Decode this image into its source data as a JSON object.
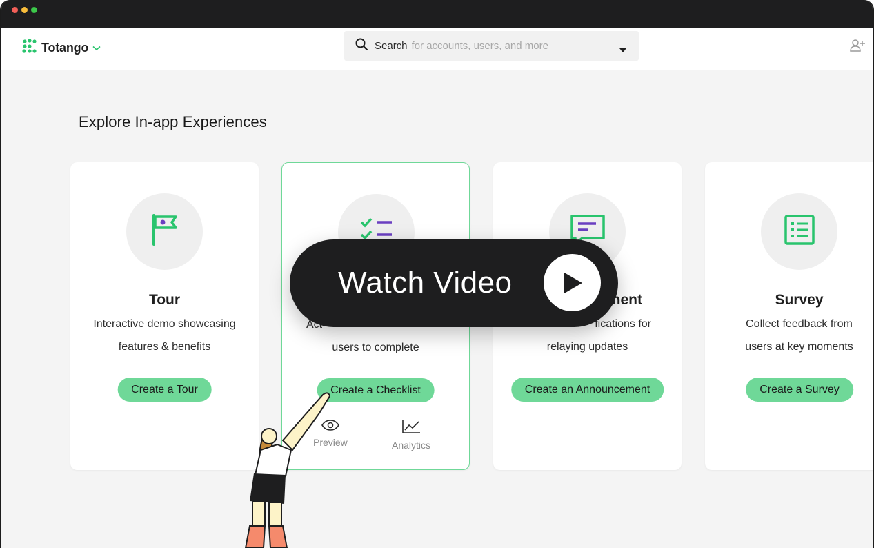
{
  "app": {
    "logo_name": "Totango"
  },
  "search": {
    "label": "Search",
    "placeholder": "for accounts, users, and more"
  },
  "page": {
    "heading": "Explore In-app Experiences"
  },
  "cards": [
    {
      "title": "Tour",
      "desc_line1": "Interactive demo showcasing",
      "desc_line2": "features & benefits",
      "cta": "Create a Tour",
      "icon": "flag-icon"
    },
    {
      "title": "",
      "desc_line1": "Act",
      "desc_line2": "users to complete",
      "cta": "Create a Checklist",
      "icon": "checklist-icon",
      "preview_label": "Preview",
      "analytics_label": "Analytics"
    },
    {
      "title": "nent",
      "desc_line1": "fications for",
      "desc_line2": "relaying updates",
      "cta": "Create an Announcement",
      "icon": "announcement-icon"
    },
    {
      "title": "Survey",
      "desc_line1": "Collect feedback from",
      "desc_line2": "users at key moments",
      "cta": "Create a Survey",
      "icon": "survey-icon"
    }
  ],
  "video": {
    "label": "Watch Video"
  },
  "colors": {
    "accent": "#6fd898",
    "brand_green": "#29c46d",
    "purple": "#6a3fc1",
    "titlebar": "#1e1e1f"
  }
}
